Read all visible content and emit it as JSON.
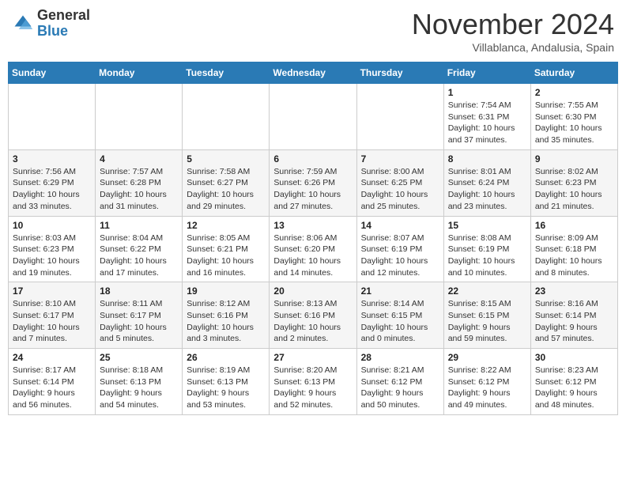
{
  "header": {
    "logo_general": "General",
    "logo_blue": "Blue",
    "month_title": "November 2024",
    "subtitle": "Villablanca, Andalusia, Spain"
  },
  "calendar": {
    "weekdays": [
      "Sunday",
      "Monday",
      "Tuesday",
      "Wednesday",
      "Thursday",
      "Friday",
      "Saturday"
    ],
    "rows": [
      [
        {
          "day": "",
          "info": ""
        },
        {
          "day": "",
          "info": ""
        },
        {
          "day": "",
          "info": ""
        },
        {
          "day": "",
          "info": ""
        },
        {
          "day": "",
          "info": ""
        },
        {
          "day": "1",
          "info": "Sunrise: 7:54 AM\nSunset: 6:31 PM\nDaylight: 10 hours and 37 minutes."
        },
        {
          "day": "2",
          "info": "Sunrise: 7:55 AM\nSunset: 6:30 PM\nDaylight: 10 hours and 35 minutes."
        }
      ],
      [
        {
          "day": "3",
          "info": "Sunrise: 7:56 AM\nSunset: 6:29 PM\nDaylight: 10 hours and 33 minutes."
        },
        {
          "day": "4",
          "info": "Sunrise: 7:57 AM\nSunset: 6:28 PM\nDaylight: 10 hours and 31 minutes."
        },
        {
          "day": "5",
          "info": "Sunrise: 7:58 AM\nSunset: 6:27 PM\nDaylight: 10 hours and 29 minutes."
        },
        {
          "day": "6",
          "info": "Sunrise: 7:59 AM\nSunset: 6:26 PM\nDaylight: 10 hours and 27 minutes."
        },
        {
          "day": "7",
          "info": "Sunrise: 8:00 AM\nSunset: 6:25 PM\nDaylight: 10 hours and 25 minutes."
        },
        {
          "day": "8",
          "info": "Sunrise: 8:01 AM\nSunset: 6:24 PM\nDaylight: 10 hours and 23 minutes."
        },
        {
          "day": "9",
          "info": "Sunrise: 8:02 AM\nSunset: 6:23 PM\nDaylight: 10 hours and 21 minutes."
        }
      ],
      [
        {
          "day": "10",
          "info": "Sunrise: 8:03 AM\nSunset: 6:23 PM\nDaylight: 10 hours and 19 minutes."
        },
        {
          "day": "11",
          "info": "Sunrise: 8:04 AM\nSunset: 6:22 PM\nDaylight: 10 hours and 17 minutes."
        },
        {
          "day": "12",
          "info": "Sunrise: 8:05 AM\nSunset: 6:21 PM\nDaylight: 10 hours and 16 minutes."
        },
        {
          "day": "13",
          "info": "Sunrise: 8:06 AM\nSunset: 6:20 PM\nDaylight: 10 hours and 14 minutes."
        },
        {
          "day": "14",
          "info": "Sunrise: 8:07 AM\nSunset: 6:19 PM\nDaylight: 10 hours and 12 minutes."
        },
        {
          "day": "15",
          "info": "Sunrise: 8:08 AM\nSunset: 6:19 PM\nDaylight: 10 hours and 10 minutes."
        },
        {
          "day": "16",
          "info": "Sunrise: 8:09 AM\nSunset: 6:18 PM\nDaylight: 10 hours and 8 minutes."
        }
      ],
      [
        {
          "day": "17",
          "info": "Sunrise: 8:10 AM\nSunset: 6:17 PM\nDaylight: 10 hours and 7 minutes."
        },
        {
          "day": "18",
          "info": "Sunrise: 8:11 AM\nSunset: 6:17 PM\nDaylight: 10 hours and 5 minutes."
        },
        {
          "day": "19",
          "info": "Sunrise: 8:12 AM\nSunset: 6:16 PM\nDaylight: 10 hours and 3 minutes."
        },
        {
          "day": "20",
          "info": "Sunrise: 8:13 AM\nSunset: 6:16 PM\nDaylight: 10 hours and 2 minutes."
        },
        {
          "day": "21",
          "info": "Sunrise: 8:14 AM\nSunset: 6:15 PM\nDaylight: 10 hours and 0 minutes."
        },
        {
          "day": "22",
          "info": "Sunrise: 8:15 AM\nSunset: 6:15 PM\nDaylight: 9 hours and 59 minutes."
        },
        {
          "day": "23",
          "info": "Sunrise: 8:16 AM\nSunset: 6:14 PM\nDaylight: 9 hours and 57 minutes."
        }
      ],
      [
        {
          "day": "24",
          "info": "Sunrise: 8:17 AM\nSunset: 6:14 PM\nDaylight: 9 hours and 56 minutes."
        },
        {
          "day": "25",
          "info": "Sunrise: 8:18 AM\nSunset: 6:13 PM\nDaylight: 9 hours and 54 minutes."
        },
        {
          "day": "26",
          "info": "Sunrise: 8:19 AM\nSunset: 6:13 PM\nDaylight: 9 hours and 53 minutes."
        },
        {
          "day": "27",
          "info": "Sunrise: 8:20 AM\nSunset: 6:13 PM\nDaylight: 9 hours and 52 minutes."
        },
        {
          "day": "28",
          "info": "Sunrise: 8:21 AM\nSunset: 6:12 PM\nDaylight: 9 hours and 50 minutes."
        },
        {
          "day": "29",
          "info": "Sunrise: 8:22 AM\nSunset: 6:12 PM\nDaylight: 9 hours and 49 minutes."
        },
        {
          "day": "30",
          "info": "Sunrise: 8:23 AM\nSunset: 6:12 PM\nDaylight: 9 hours and 48 minutes."
        }
      ]
    ]
  }
}
